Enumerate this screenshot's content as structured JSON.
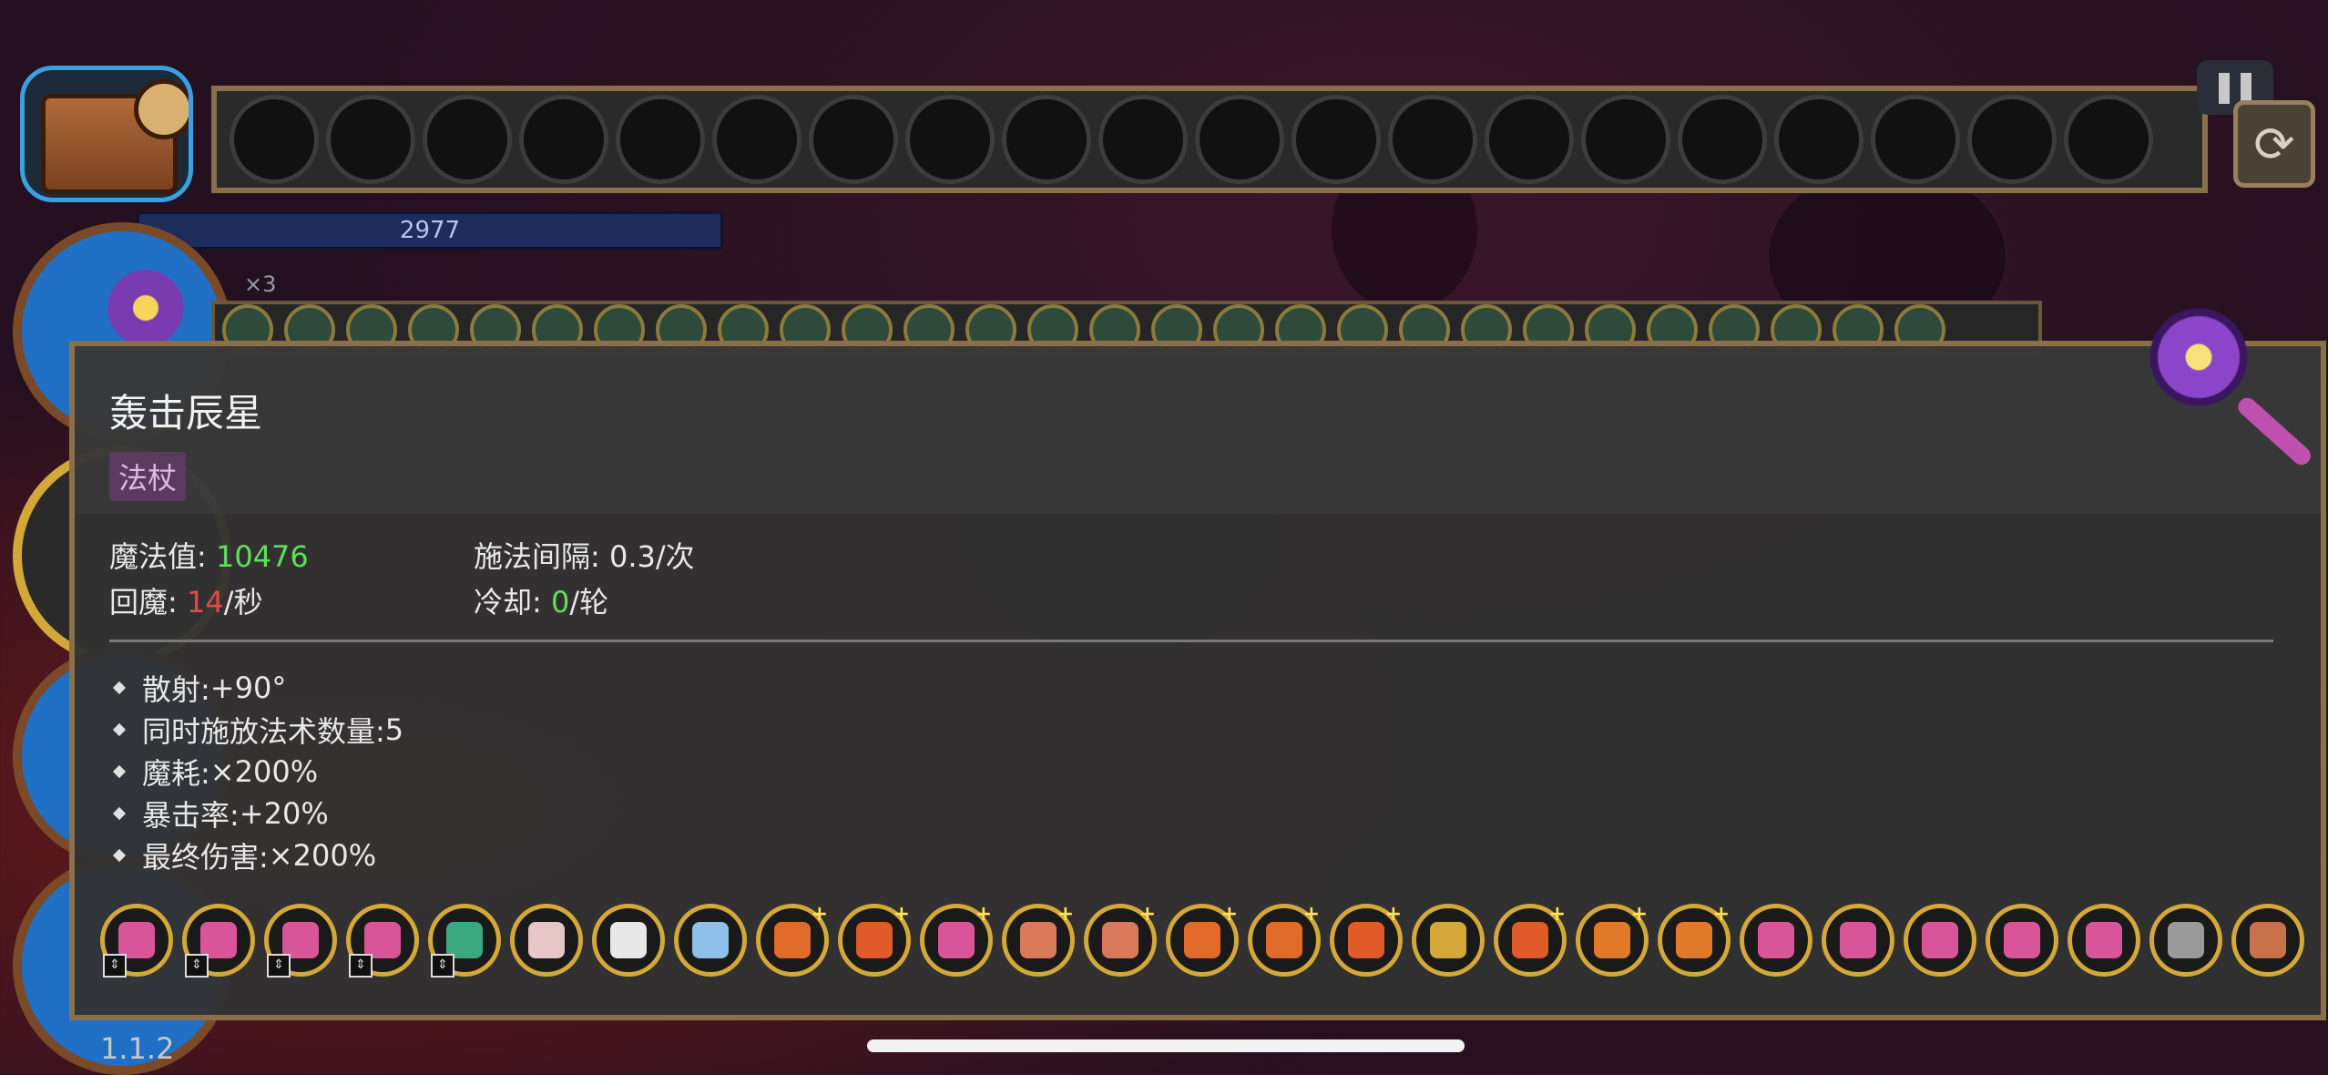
{
  "hud": {
    "mana_bar_value": "2977",
    "multiplier": "×3",
    "version": "1.1.2",
    "inventory_slot_count": 20,
    "colors": {
      "mana_bar": "#1d2c5c",
      "frame": "#8a7048",
      "backpack_border": "#3aa0e0"
    }
  },
  "tooltip": {
    "title": "轰击辰星",
    "tag": "法杖",
    "stats": {
      "mana_label": "魔法值: ",
      "mana_value": "10476",
      "regen_label": "回魔: ",
      "regen_value": "14",
      "regen_unit": "/秒",
      "cast_interval": "施法间隔: 0.3/次",
      "cooldown_label": "冷却: ",
      "cooldown_value": "0",
      "cooldown_unit": "/轮"
    },
    "modifiers": [
      {
        "label": "散射: ",
        "value": "+90°"
      },
      {
        "label": "同时施放法术数量: ",
        "value": "5"
      },
      {
        "label": "魔耗: ",
        "value": "×200%"
      },
      {
        "label": "暴击率: ",
        "value": "+20%"
      },
      {
        "label": "最终伤害: ",
        "value": "×200%"
      }
    ],
    "spell_icons": [
      {
        "name": "pink-cube-icon",
        "color": "#d8559a",
        "locked": true,
        "plus": false
      },
      {
        "name": "pink-cube-icon",
        "color": "#d8559a",
        "locked": true,
        "plus": false
      },
      {
        "name": "pink-cube-icon",
        "color": "#d8559a",
        "locked": true,
        "plus": false
      },
      {
        "name": "pink-cube-icon",
        "color": "#d8559a",
        "locked": true,
        "plus": false
      },
      {
        "name": "green-rune-icon",
        "color": "#3aa880",
        "locked": true,
        "plus": false
      },
      {
        "name": "ghost-icon",
        "color": "#e6c6c6",
        "locked": false,
        "plus": false
      },
      {
        "name": "mouse-icon",
        "color": "#e8e8e8",
        "locked": false,
        "plus": false
      },
      {
        "name": "blue-orb-icon",
        "color": "#8fc0ea",
        "locked": false,
        "plus": false
      },
      {
        "name": "triple-arrow-icon",
        "color": "#e06a2a",
        "locked": false,
        "plus": true
      },
      {
        "name": "double-arrow-icon",
        "color": "#e05a2a",
        "locked": false,
        "plus": true
      },
      {
        "name": "pink-cube-icon",
        "color": "#d8559a",
        "locked": false,
        "plus": true
      },
      {
        "name": "box-icon",
        "color": "#d87a5a",
        "locked": false,
        "plus": true
      },
      {
        "name": "box-icon",
        "color": "#d87a5a",
        "locked": false,
        "plus": true
      },
      {
        "name": "triple-arrow-icon",
        "color": "#e06a2a",
        "locked": false,
        "plus": true
      },
      {
        "name": "triple-arrow-icon",
        "color": "#e06a2a",
        "locked": false,
        "plus": true
      },
      {
        "name": "double-arrow-icon",
        "color": "#e05a2a",
        "locked": false,
        "plus": true
      },
      {
        "name": "golden-eye-icon",
        "color": "#d4a838",
        "locked": false,
        "plus": false
      },
      {
        "name": "double-arrow-icon",
        "color": "#e05a2a",
        "locked": false,
        "plus": true
      },
      {
        "name": "fire-burst-icon",
        "color": "#e07a2a",
        "locked": false,
        "plus": true
      },
      {
        "name": "fire-burst-icon",
        "color": "#e07a2a",
        "locked": false,
        "plus": true
      },
      {
        "name": "pink-cube-icon",
        "color": "#d8559a",
        "locked": false,
        "plus": false
      },
      {
        "name": "pink-cube-icon",
        "color": "#d8559a",
        "locked": false,
        "plus": false
      },
      {
        "name": "pink-cube-icon",
        "color": "#d8559a",
        "locked": false,
        "plus": false
      },
      {
        "name": "pink-cube-icon",
        "color": "#d8559a",
        "locked": false,
        "plus": false
      },
      {
        "name": "pink-cube-icon",
        "color": "#d8559a",
        "locked": false,
        "plus": false
      },
      {
        "name": "slash-icon",
        "color": "#9a9a9a",
        "locked": false,
        "plus": false
      },
      {
        "name": "rock-icon",
        "color": "#c8704a",
        "locked": false,
        "plus": false
      }
    ],
    "colors": {
      "green": "#5ee05a",
      "red": "#e04a4a",
      "tag_bg": "#5a3a5e"
    }
  }
}
